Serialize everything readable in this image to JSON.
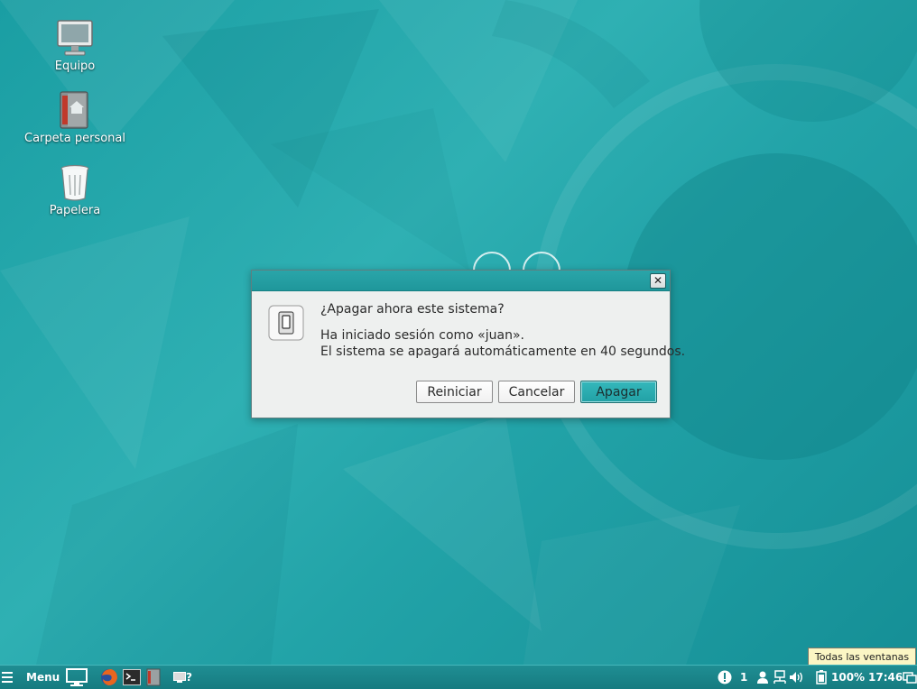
{
  "desktop": {
    "icons": [
      {
        "label": "Equipo",
        "icon": "computer-icon"
      },
      {
        "label": "Carpeta personal",
        "icon": "home-folder-icon"
      },
      {
        "label": "Papelera",
        "icon": "trash-icon"
      }
    ]
  },
  "dialog": {
    "close_symbol": "✕",
    "icon": "power-switch-icon",
    "question": "¿Apagar ahora este sistema?",
    "line1": "Ha iniciado sesión como «juan».",
    "line2": "El sistema se apagará automáticamente en 40 segundos.",
    "buttons": {
      "restart": "Reiniciar",
      "cancel": "Cancelar",
      "poweroff": "Apagar"
    }
  },
  "panel": {
    "menu_label": "Menu",
    "launcher_suffix": "?",
    "workspace": "1",
    "battery": "100%",
    "clock": "17:46"
  },
  "tooltip": {
    "text": "Todas las ventanas"
  },
  "colors": {
    "wallpaper": "#22a3a8",
    "panel": "#1a848a",
    "dialog_title": "#23a0a4",
    "default_button": "#2aabb0"
  }
}
